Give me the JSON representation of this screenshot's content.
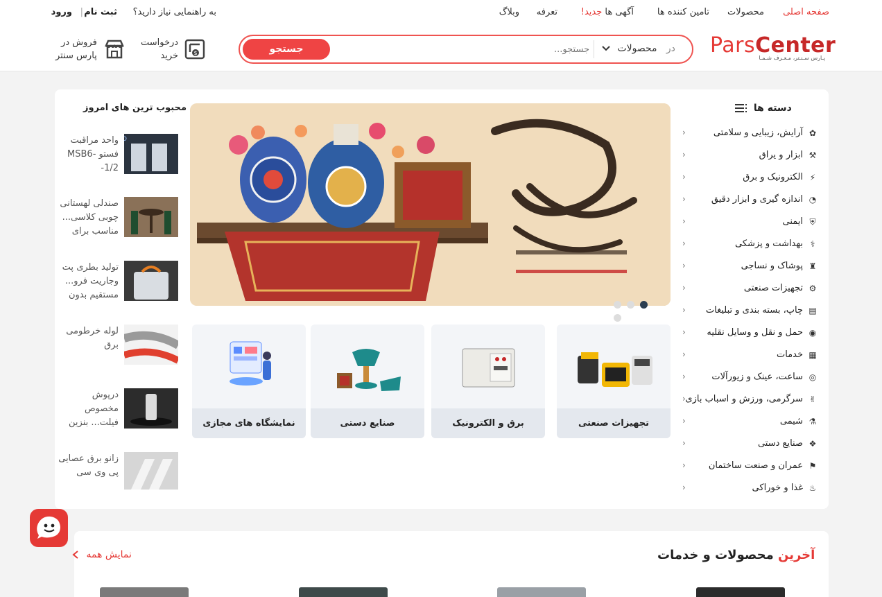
{
  "header": {
    "nav": {
      "home": "صفحه اصلی",
      "products": "محصولات",
      "suppliers": "تامین کننده ها",
      "ads": "آگهی ها",
      "ads_badge": "جدید!",
      "pricing": "تعرفه",
      "blog": "وبلاگ"
    },
    "help_text": "به راهنمایی نیاز دارید؟",
    "register": "ثبت نام",
    "separator": "|",
    "login": "ورود",
    "logo": {
      "pars": "Pars",
      "center": "Center",
      "tagline": "پـارس سـنـتر، مـعـرف شـمـا"
    },
    "search": {
      "scope_label": "در",
      "scope_value": "محصولات",
      "placeholder": "جستجو...",
      "button": "جستجو"
    },
    "purchase_request": {
      "line1": "درخواست",
      "line2": "خرید"
    },
    "sell": {
      "line1": "فروش در",
      "line2": "پارس سنتر"
    }
  },
  "categories": {
    "title": "دسته ها",
    "items": [
      {
        "label": "آرایش، زیبایی و سلامتی",
        "icon": "cosmetics-icon"
      },
      {
        "label": "ابزار و یراق",
        "icon": "tools-icon"
      },
      {
        "label": "الکترونیک و برق",
        "icon": "electronics-icon"
      },
      {
        "label": "اندازه گیری و ابزار دقیق",
        "icon": "gauge-icon"
      },
      {
        "label": "ایمنی",
        "icon": "safety-icon"
      },
      {
        "label": "بهداشت و پزشکی",
        "icon": "stethoscope-icon"
      },
      {
        "label": "پوشاک و نساجی",
        "icon": "shirt-icon"
      },
      {
        "label": "تجهیزات صنعتی",
        "icon": "industry-icon"
      },
      {
        "label": "چاپ، بسته بندی و تبلیغات",
        "icon": "print-icon"
      },
      {
        "label": "حمل و نقل و وسایل نقلیه",
        "icon": "vehicle-icon"
      },
      {
        "label": "خدمات",
        "icon": "services-icon"
      },
      {
        "label": "ساعت، عینک و زیورآلات",
        "icon": "ring-icon"
      },
      {
        "label": "سرگرمی، ورزش و اسباب بازی",
        "icon": "toy-icon"
      },
      {
        "label": "شیمی",
        "icon": "flask-icon"
      },
      {
        "label": "صنایع دستی",
        "icon": "craft-icon"
      },
      {
        "label": "عمران و صنعت ساختمان",
        "icon": "construction-icon"
      },
      {
        "label": "غذا و خوراکی",
        "icon": "food-icon"
      }
    ]
  },
  "banner": {
    "slide_count": 4,
    "active_slide": 3
  },
  "tiles": [
    {
      "label": "تجهیزات صنعتی"
    },
    {
      "label": "برق و الکترونیک"
    },
    {
      "label": "صنایع دستی"
    },
    {
      "label": "نمایشگاه های مجازی"
    }
  ],
  "popular": {
    "title": "محبوب ترین های امروز",
    "items": [
      {
        "text": "واحد مراقبت فستو MSB6- 1/2-"
      },
      {
        "text": "صندلی لهستانی چوبی کلاسی... مناسب برای"
      },
      {
        "text": "تولید بطری پت وجاریت فرو... مستقیم بدون"
      },
      {
        "text": "لوله خرطومی برق"
      },
      {
        "text": "درپوش مخصوص فیلت... بنزین"
      },
      {
        "text": "زانو برق عصایی پی وی سی"
      }
    ]
  },
  "latest": {
    "title_accent": "آخرین",
    "title_rest": "محصولات و خدمات",
    "show_all": "نمایش همه"
  },
  "colors": {
    "accent": "#e53935",
    "search_button": "#ef4444",
    "active_dot": "#2c3e50"
  }
}
